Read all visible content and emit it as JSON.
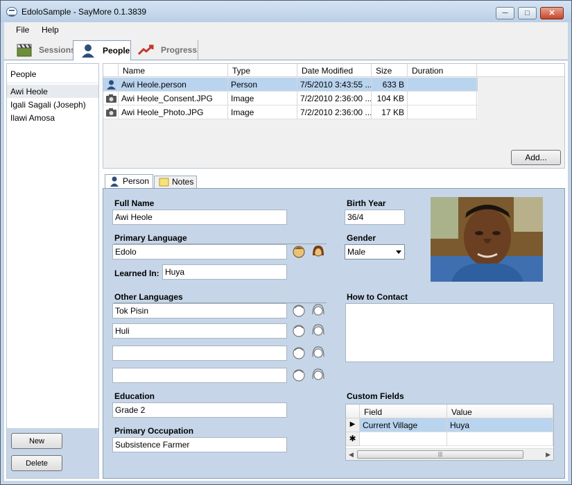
{
  "window": {
    "title": "EdoloSample - SayMore 0.1.3839",
    "min_glyph": "─",
    "max_glyph": "□",
    "close_glyph": "✕"
  },
  "menu": {
    "file": "File",
    "help": "Help"
  },
  "main_tabs": {
    "sessions": "Sessions",
    "people": "People",
    "progress": "Progress"
  },
  "people_list": {
    "header": "People",
    "items": [
      "Awi Heole",
      "Igali Sagali (Joseph)",
      "Ilawi Amosa"
    ],
    "new_label": "New",
    "delete_label": "Delete"
  },
  "files": {
    "columns": [
      "Name",
      "Type",
      "Date Modified",
      "Size",
      "Duration"
    ],
    "rows": [
      {
        "name": "Awi Heole.person",
        "type": "Person",
        "date": "7/5/2010 3:43:55 ...",
        "size": "633 B",
        "duration": ""
      },
      {
        "name": "Awi Heole_Consent.JPG",
        "type": "Image",
        "date": "7/2/2010 2:36:00 ...",
        "size": "104 KB",
        "duration": ""
      },
      {
        "name": "Awi Heole_Photo.JPG",
        "type": "Image",
        "date": "7/2/2010 2:36:00 ...",
        "size": "17 KB",
        "duration": ""
      }
    ],
    "add_label": "Add..."
  },
  "detail_tabs": {
    "person": "Person",
    "notes": "Notes"
  },
  "person": {
    "full_name_label": "Full Name",
    "full_name": "Awi Heole",
    "birth_year_label": "Birth Year",
    "birth_year": "36/4",
    "primary_language_label": "Primary Language",
    "primary_language": "Edolo",
    "learned_in_label": "Learned In:",
    "learned_in": "Huya",
    "gender_label": "Gender",
    "gender": "Male",
    "other_languages_label": "Other Languages",
    "other_languages": [
      "Tok Pisin",
      "Huli",
      "",
      ""
    ],
    "how_to_contact_label": "How to Contact",
    "how_to_contact": "",
    "education_label": "Education",
    "education": "Grade 2",
    "primary_occupation_label": "Primary Occupation",
    "primary_occupation": "Subsistence Farmer",
    "custom_fields_label": "Custom Fields",
    "custom_fields": {
      "columns": [
        "Field",
        "Value"
      ],
      "rows": [
        {
          "field": "Current Village",
          "value": "Huya"
        }
      ],
      "new_row_marker": "✱",
      "selected_marker": "▶",
      "scroll_left": "◀",
      "scroll_right": "▶",
      "thumb_grip": "|||"
    }
  },
  "colors": {
    "panel_bg": "#c6d6e8",
    "selected_row": "#b9d4ef",
    "progress_icon": "#c0392b"
  }
}
